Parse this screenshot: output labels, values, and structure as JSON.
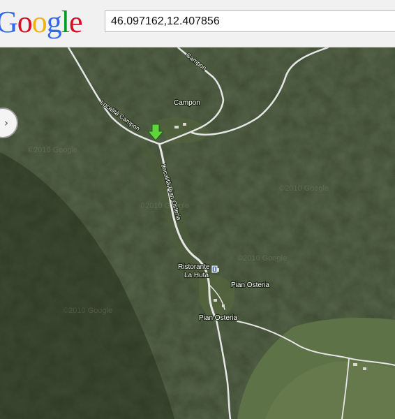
{
  "brand": {
    "letters": [
      {
        "ch": "G",
        "color": "#3369e8"
      },
      {
        "ch": "o",
        "color": "#d50f25"
      },
      {
        "ch": "o",
        "color": "#eeb211"
      },
      {
        "ch": "g",
        "color": "#3369e8"
      },
      {
        "ch": "l",
        "color": "#009925"
      },
      {
        "ch": "e",
        "color": "#d50f25"
      }
    ]
  },
  "search": {
    "value": "46.097162,12.407856"
  },
  "map": {
    "view": "satellite",
    "places": {
      "campon": "Campon",
      "ristorante": "Ristorante",
      "ristorante_line2": "La Huta",
      "pian_osteria_east": "Pian Osteria",
      "pian_osteria_south": "Pian Osteria"
    },
    "roads": {
      "campon_north": "Campon",
      "localita_campon": "Località Campon",
      "localita_pian_osteria": "Località Pian Osteria"
    },
    "watermark": "©2010 Google",
    "marker_icon": "green-arrow-marker",
    "colors": {
      "forest_dark": "#27321c",
      "forest": "#35432a",
      "meadow": "#5c7046",
      "road": "#e8e8e8",
      "marker": "#5fd43c"
    }
  },
  "nav_control": {
    "icon": "pan-right-icon",
    "glyph": "›"
  }
}
